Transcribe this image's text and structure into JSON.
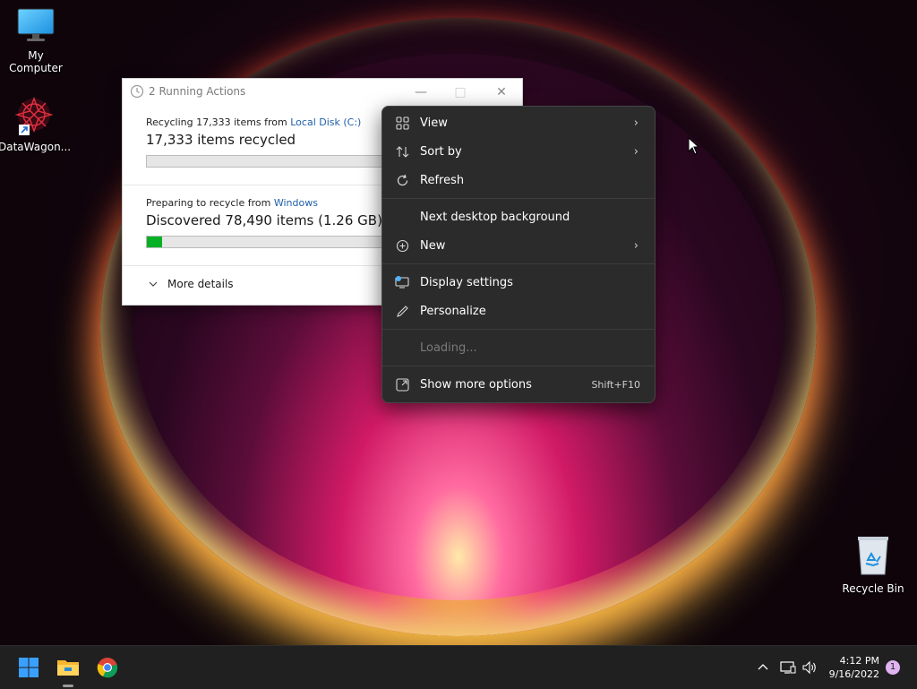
{
  "desktop": {
    "icons": [
      {
        "label": "My Computer",
        "icon": "monitor-icon"
      },
      {
        "label": "DataWagon...",
        "icon": "datawagon-shortcut-icon"
      },
      {
        "label": "Recycle Bin",
        "icon": "recycle-bin-icon"
      }
    ]
  },
  "running_actions": {
    "title": "2 Running Actions",
    "controls": {
      "minimize": "—",
      "maximize": "□",
      "close": "✕"
    },
    "action1": {
      "prefix": "Recycling 17,333 items from ",
      "location": "Local Disk (C:)",
      "status": "17,333 items recycled",
      "progress": 0
    },
    "action2": {
      "prefix": "Preparing to recycle from ",
      "location": "Windows",
      "status": "Discovered 78,490 items (1.26 GB)...",
      "progress": 0.06
    },
    "more_details": "More details",
    "accent": "#06b025"
  },
  "context_menu": {
    "items": [
      {
        "label": "View",
        "icon": "grid-icon",
        "submenu": true
      },
      {
        "label": "Sort by",
        "icon": "sort-icon",
        "submenu": true
      },
      {
        "label": "Refresh",
        "icon": "refresh-icon"
      },
      {
        "label": "Next desktop background"
      },
      {
        "label": "New",
        "icon": "plus-circle-icon",
        "submenu": true
      },
      {
        "label": "Display settings",
        "icon": "display-settings-icon"
      },
      {
        "label": "Personalize",
        "icon": "pen-icon"
      },
      {
        "label": "Loading...",
        "disabled": true
      },
      {
        "label": "Show more options",
        "icon": "expand-icon",
        "shortcut": "Shift+F10"
      }
    ]
  },
  "taskbar": {
    "clock_time": "4:12 PM",
    "clock_date": "9/16/2022",
    "notification_count": "1",
    "apps": [
      "start-icon",
      "file-explorer-icon",
      "chrome-icon"
    ],
    "tray": [
      "chevron-up-icon",
      "network-icon",
      "volume-icon"
    ]
  }
}
